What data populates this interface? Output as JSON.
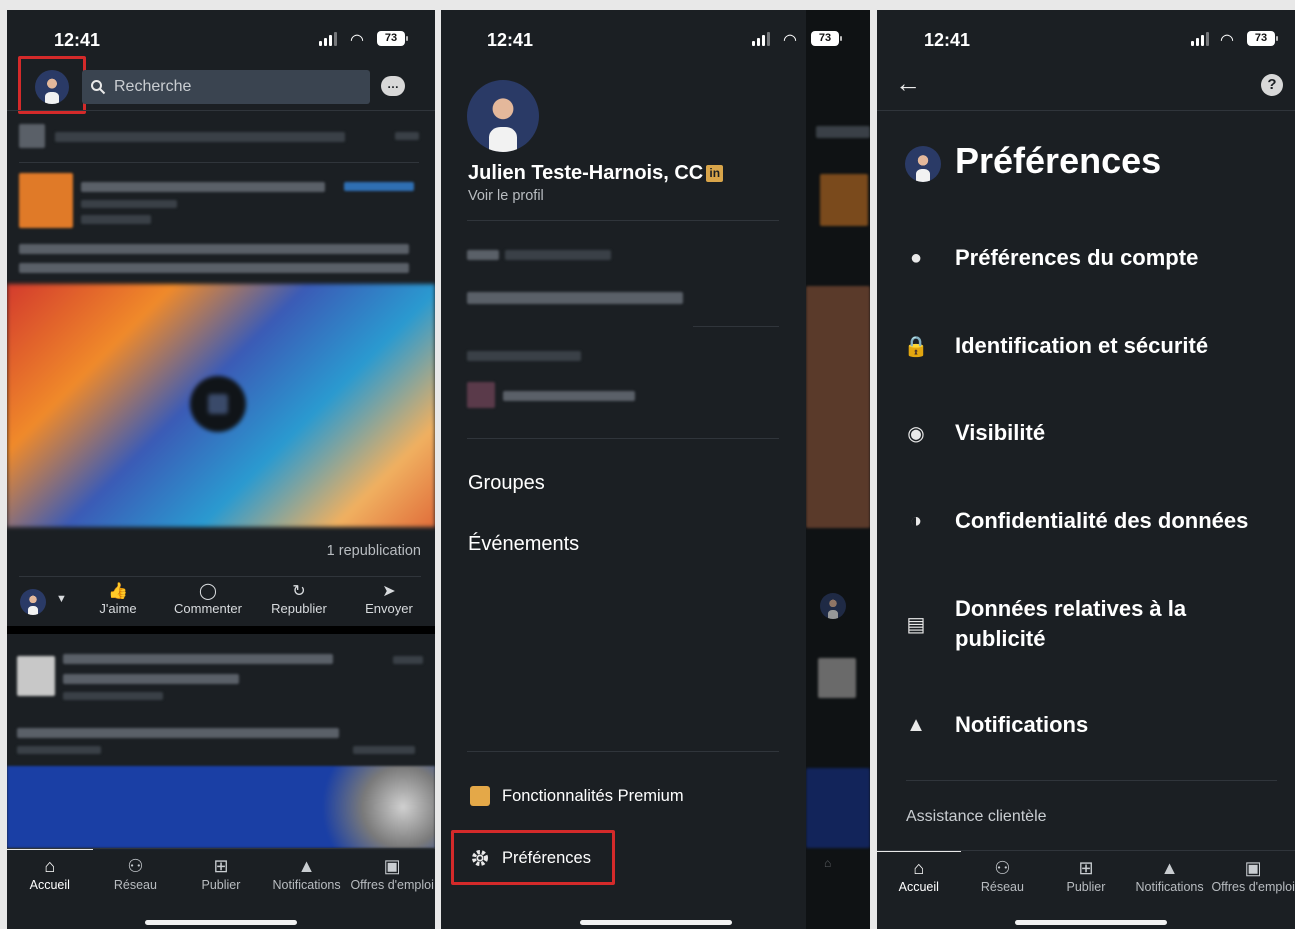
{
  "status": {
    "time": "12:41",
    "battery": "73"
  },
  "panel1": {
    "search_placeholder": "Recherche",
    "reposts": "1 republication",
    "actions": [
      {
        "label": "J'aime",
        "icon": "thumbs-up-icon",
        "glyph": "👍"
      },
      {
        "label": "Commenter",
        "icon": "comment-icon",
        "glyph": "◯"
      },
      {
        "label": "Republier",
        "icon": "repost-icon",
        "glyph": "↻"
      },
      {
        "label": "Envoyer",
        "icon": "send-icon",
        "glyph": "➤"
      }
    ]
  },
  "panel2": {
    "name": "Julien Teste-Harnois, CC",
    "badge": "in",
    "view_profile": "Voir le profil",
    "groups": "Groupes",
    "events": "Événements",
    "premium": "Fonctionnalités Premium",
    "preferences": "Préférences"
  },
  "panel3": {
    "title": "Préférences",
    "help": "?",
    "items": [
      {
        "label": "Préférences du compte",
        "icon": "person-icon",
        "glyph": "●"
      },
      {
        "label": "Identification et sécurité",
        "icon": "lock-icon",
        "glyph": "🔒"
      },
      {
        "label": "Visibilité",
        "icon": "eye-icon",
        "glyph": "◉"
      },
      {
        "label": "Confidentialité des données",
        "icon": "shield-icon",
        "glyph": "◑"
      },
      {
        "label": "Données relatives à la publicité",
        "icon": "ad-icon",
        "glyph": "▤"
      },
      {
        "label": "Notifications",
        "icon": "bell-icon",
        "glyph": "▲"
      }
    ],
    "assistance": "Assistance clientèle"
  },
  "nav": [
    {
      "label": "Accueil",
      "icon": "home-icon",
      "glyph": "⌂"
    },
    {
      "label": "Réseau",
      "icon": "network-icon",
      "glyph": "⚇"
    },
    {
      "label": "Publier",
      "icon": "post-icon",
      "glyph": "⊞"
    },
    {
      "label": "Notifications",
      "icon": "bell-icon",
      "glyph": "▲"
    },
    {
      "label": "Offres d'emploi",
      "icon": "briefcase-icon",
      "glyph": "▣"
    }
  ],
  "colors": {
    "background": "#1b1f23",
    "highlight": "#d42a2a",
    "premium": "#e4a848"
  }
}
